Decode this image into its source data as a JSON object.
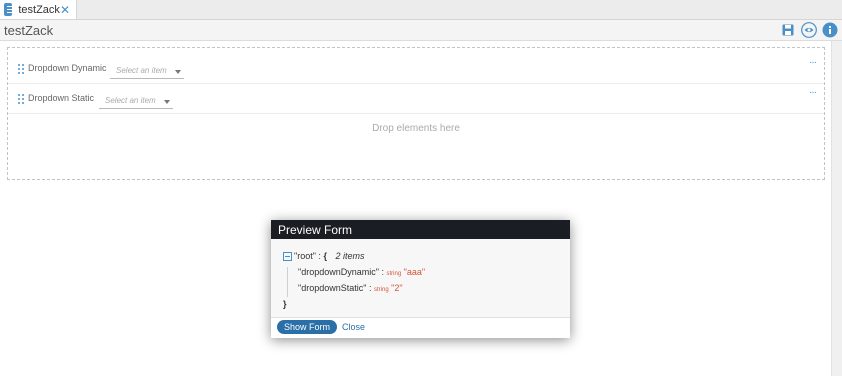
{
  "tabs": [
    {
      "label": "testZack",
      "close": "✕"
    }
  ],
  "page": {
    "title": "testZack"
  },
  "header_actions": [
    {
      "name": "save",
      "icon": "save-icon"
    },
    {
      "name": "preview",
      "icon": "eye-icon"
    },
    {
      "name": "info",
      "icon": "info-icon"
    }
  ],
  "form": {
    "fields": [
      {
        "label": "Dropdown Dynamic",
        "placeholder": "Select an item",
        "menu": "···"
      },
      {
        "label": "Dropdown Static",
        "placeholder": "Select an item",
        "menu": "···"
      }
    ],
    "drop_hint": "Drop elements here"
  },
  "modal": {
    "title": "Preview Form",
    "root_key": "\"root\"",
    "colon": ":",
    "open_brace": "{",
    "close_brace": "}",
    "count": "2 items",
    "entries": [
      {
        "key": "\"dropdownDynamic\"",
        "type": "string",
        "value": "\"aaa\""
      },
      {
        "key": "\"dropdownStatic\"",
        "type": "string",
        "value": "\"2\""
      }
    ],
    "primary_button": "Show Form",
    "secondary_button": "Close"
  },
  "colors": {
    "accent": "#4a90c8",
    "modal_header": "#1a1d24",
    "button": "#2a6fa8",
    "json_value": "#d6543a"
  }
}
